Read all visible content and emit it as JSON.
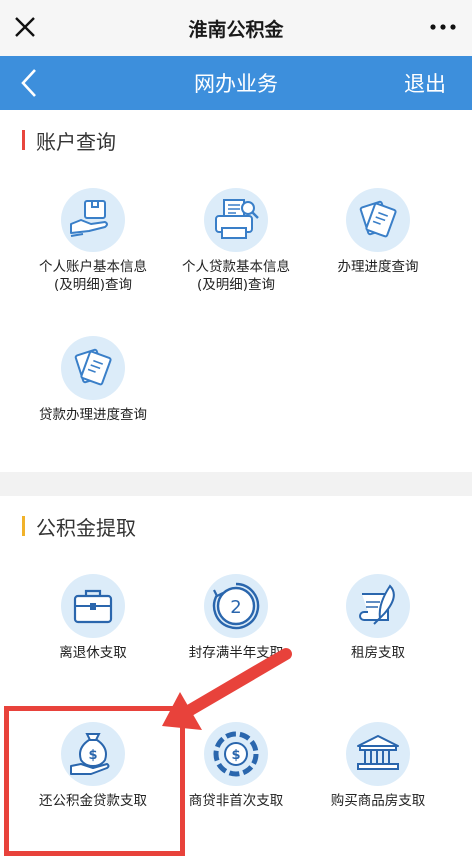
{
  "wechat": {
    "title": "淮南公积金"
  },
  "app_bar": {
    "title": "网办业务",
    "logout_label": "退出"
  },
  "sections": [
    {
      "title": "账户查询",
      "items": [
        {
          "label_lines": [
            "个人账户基本信息",
            "(及明细)查询"
          ],
          "icon": "hand-box-icon"
        },
        {
          "label_lines": [
            "个人贷款基本信息",
            "(及明细)查询"
          ],
          "icon": "printer-search-icon"
        },
        {
          "label_lines": [
            "办理进度查询"
          ],
          "icon": "documents-icon"
        },
        {
          "label_lines": [
            "贷款办理进度查询"
          ],
          "icon": "documents-icon"
        }
      ]
    },
    {
      "title": "公积金提取",
      "items": [
        {
          "label_lines": [
            "离退休支取"
          ],
          "icon": "briefcase-icon"
        },
        {
          "label_lines": [
            "封存满半年支取"
          ],
          "icon": "cycle-2-icon"
        },
        {
          "label_lines": [
            "租房支取"
          ],
          "icon": "feather-scroll-icon"
        },
        {
          "label_lines": [
            "还公积金贷款支取"
          ],
          "icon": "money-bag-hand-icon"
        },
        {
          "label_lines": [
            "商贷非首次支取"
          ],
          "icon": "dollar-chart-icon"
        },
        {
          "label_lines": [
            "购买商品房支取"
          ],
          "icon": "bank-building-icon"
        }
      ]
    }
  ],
  "colors": {
    "app_bar": "#3d8fdc",
    "icon_bg": "#dcecf9",
    "highlight": "#e8423b",
    "section1_accent": "#e8463d",
    "section2_accent": "#f1b22a"
  }
}
